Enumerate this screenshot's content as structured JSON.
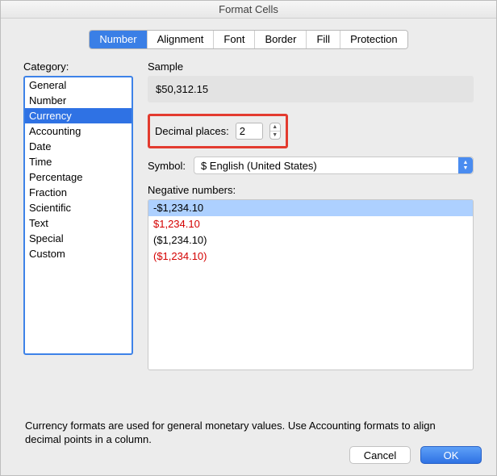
{
  "window": {
    "title": "Format Cells"
  },
  "tabs": [
    {
      "label": "Number",
      "active": true
    },
    {
      "label": "Alignment",
      "active": false
    },
    {
      "label": "Font",
      "active": false
    },
    {
      "label": "Border",
      "active": false
    },
    {
      "label": "Fill",
      "active": false
    },
    {
      "label": "Protection",
      "active": false
    }
  ],
  "category": {
    "label": "Category:",
    "items": [
      "General",
      "Number",
      "Currency",
      "Accounting",
      "Date",
      "Time",
      "Percentage",
      "Fraction",
      "Scientific",
      "Text",
      "Special",
      "Custom"
    ],
    "selected_index": 2
  },
  "sample": {
    "label": "Sample",
    "value": "$50,312.15"
  },
  "decimal": {
    "label": "Decimal places:",
    "value": "2"
  },
  "symbol": {
    "label": "Symbol:",
    "value": "$ English (United States)"
  },
  "negative": {
    "label": "Negative numbers:",
    "items": [
      {
        "text": "-$1,234.10",
        "red": false,
        "selected": true
      },
      {
        "text": "$1,234.10",
        "red": true,
        "selected": false
      },
      {
        "text": "($1,234.10)",
        "red": false,
        "selected": false
      },
      {
        "text": "($1,234.10)",
        "red": true,
        "selected": false
      }
    ]
  },
  "description": "Currency formats are used for general monetary values.  Use Accounting formats to align decimal points in a column.",
  "buttons": {
    "cancel": "Cancel",
    "ok": "OK"
  }
}
